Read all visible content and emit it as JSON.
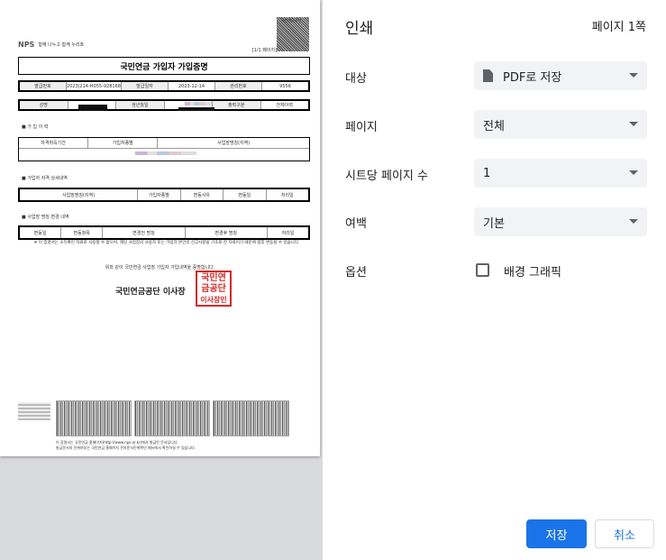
{
  "panel": {
    "title": "인쇄",
    "page_count": "페이지 1쪽",
    "destination": {
      "label": "대상",
      "value": "PDF로 저장",
      "icon": "file-icon"
    },
    "pages": {
      "label": "페이지",
      "value": "전체"
    },
    "pages_per_sheet": {
      "label": "시트당 페이지 수",
      "value": "1"
    },
    "margins": {
      "label": "여백",
      "value": "기본"
    },
    "options": {
      "label": "옵션",
      "background_graphics": "배경 그래픽",
      "background_graphics_checked": false
    },
    "save_button": "저장",
    "cancel_button": "취소"
  },
  "document": {
    "logo_text": "NPS",
    "slogan": "함께 나누고 함께 누리죠",
    "page_indicator": "[1/1 페이지]",
    "qr_label": "국민연금공단",
    "title": "국민연금 가입자 가입증명",
    "row1": [
      "발급번호",
      "2023|214-H055-928168",
      "발급일자",
      "2023-12-14",
      "관리번호",
      "9556"
    ],
    "row2": [
      "성명",
      "",
      "생년월일",
      "",
      "출력구분",
      "전체이력"
    ],
    "section1": "■ 가 입 이 력",
    "section1_cols": [
      "자격취득기간",
      "가입자종별",
      "사업장명칭(지역)"
    ],
    "section2": "■ 가입자 자격 상세내역",
    "section2_cols": [
      "사업장명칭(지역)",
      "가입자종별",
      "변동사유",
      "변동일",
      "처리일"
    ],
    "section3": "■ 사업장 명칭 변경 내역",
    "section3_cols": [
      "변동일",
      "변동항목",
      "변경전 명칭",
      "변경후 명칭",
      "처리일"
    ],
    "notice": "※ 이 증명서는 소득확인 자료로 사용할 수 없으며, 해당 사업장의 사용자 또는 가입자 본인의 신고사항을 기초로 한 자료이기 때문에 향후 변동될 수 있습니다.",
    "certify_text": "위와 같이 국민연금 사업장 가입자 가입내역을 증명합니다.",
    "issuer": "국민연금공단 이사장",
    "stamp_text": "국민연금공단이사장인",
    "footer1": "이 증명서는 국민연금 홈페이지(http://www.nps.or.kr)에서 발급된 문서입니다.",
    "footer2": "발급문서의 진위여부는 국민연금 홈페이지 전자문서진위확인 메뉴에서 확인하실 수 있습니다."
  }
}
